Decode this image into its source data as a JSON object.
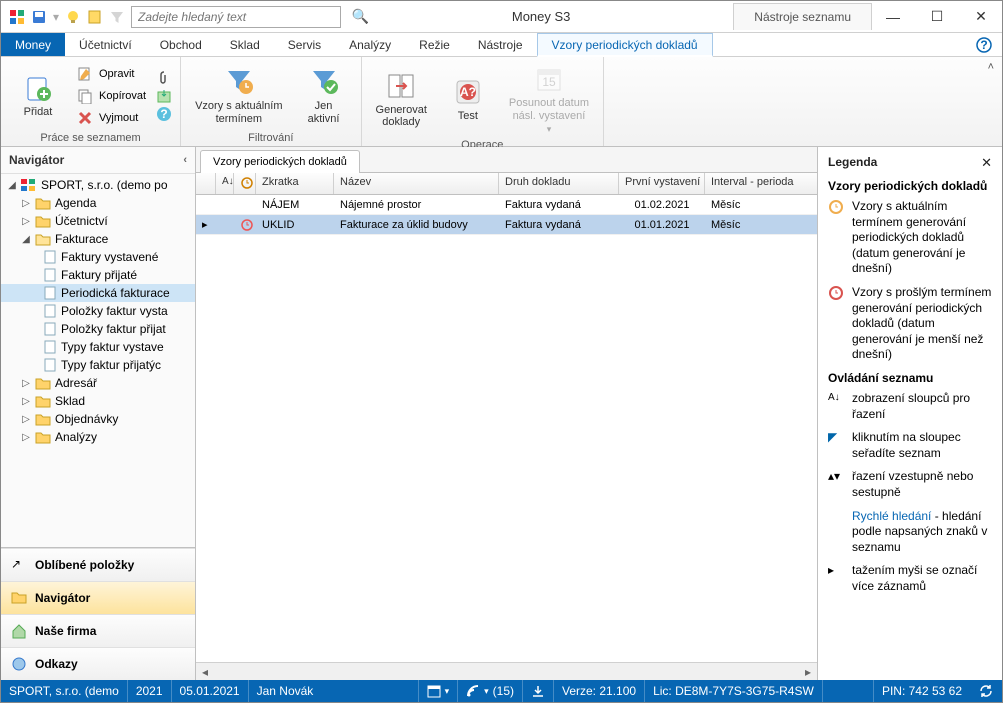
{
  "title": "Money S3",
  "contextTab": "Nástroje seznamu",
  "search": {
    "placeholder": "Zadejte hledaný text"
  },
  "menu": {
    "items": [
      "Money",
      "Účetnictví",
      "Obchod",
      "Sklad",
      "Servis",
      "Analýzy",
      "Režie",
      "Nástroje",
      "Vzory periodických dokladů"
    ]
  },
  "ribbon": {
    "group1": {
      "label": "Práce se seznamem",
      "add": "Přidat",
      "opravit": "Opravit",
      "kopirovat": "Kopírovat",
      "vyjmout": "Vyjmout"
    },
    "group2": {
      "label": "Filtrování",
      "vzory": "Vzory s aktuálním\ntermínem",
      "jen": "Jen\naktivní"
    },
    "group3": {
      "label": "Operace",
      "gen": "Generovat\ndoklady",
      "test": "Test",
      "posun": "Posunout datum\nnásl. vystavení"
    }
  },
  "navigator": {
    "title": "Navigátor",
    "root": "SPORT, s.r.o. (demo po",
    "items": [
      "Agenda",
      "Účetnictví",
      "Fakturace",
      "Adresář",
      "Sklad",
      "Objednávky",
      "Analýzy"
    ],
    "fakturace": [
      "Faktury vystavené",
      "Faktury přijaté",
      "Periodická fakturace",
      "Položky faktur vysta",
      "Položky faktur přijat",
      "Typy faktur vystave",
      "Typy faktur přijatýc"
    ],
    "stack": [
      "Oblíbené položky",
      "Navigátor",
      "Naše firma",
      "Odkazy"
    ]
  },
  "content": {
    "tab": "Vzory periodických dokladů",
    "headers": {
      "zkratka": "Zkratka",
      "nazev": "Název",
      "druh": "Druh dokladu",
      "prvni": "První vystavení",
      "interval": "Interval - perioda"
    },
    "rows": [
      {
        "zkratka": "NÁJEM",
        "nazev": "Nájemné prostor",
        "druh": "Faktura vydaná",
        "prvni": "01.02.2021",
        "interval": "Měsíc",
        "selected": false,
        "alarm": false
      },
      {
        "zkratka": "UKLID",
        "nazev": "Fakturace za úklid budovy",
        "druh": "Faktura vydaná",
        "prvni": "01.01.2021",
        "interval": "Měsíc",
        "selected": true,
        "alarm": true
      }
    ]
  },
  "legend": {
    "title": "Legenda",
    "h1": "Vzory periodických dokladů",
    "i1": "Vzory s aktuálním termínem generování periodických dokladů (datum generování je dnešní)",
    "i2": "Vzory s prošlým termínem generování periodických dokladů (datum generování je menší než dnešní)",
    "h2": "Ovládání seznamu",
    "i3": "zobrazení sloupců pro řazení",
    "i4": "kliknutím na sloupec seřadíte seznam",
    "i5": "řazení vzestupně nebo sestupně",
    "i6a": "Rychlé hledání",
    "i6b": " - hledání podle napsaných znaků v seznamu",
    "i7": "tažením myši se označí více záznamů"
  },
  "statusbar": {
    "firma": "SPORT, s.r.o. (demo",
    "rok": "2021",
    "datum": "05.01.2021",
    "user": "Jan Novák",
    "rss": "(15)",
    "verze": "Verze: 21.100",
    "lic": "Lic: DE8M-7Y7S-3G75-R4SW",
    "pin": "PIN: 742 53 62"
  }
}
